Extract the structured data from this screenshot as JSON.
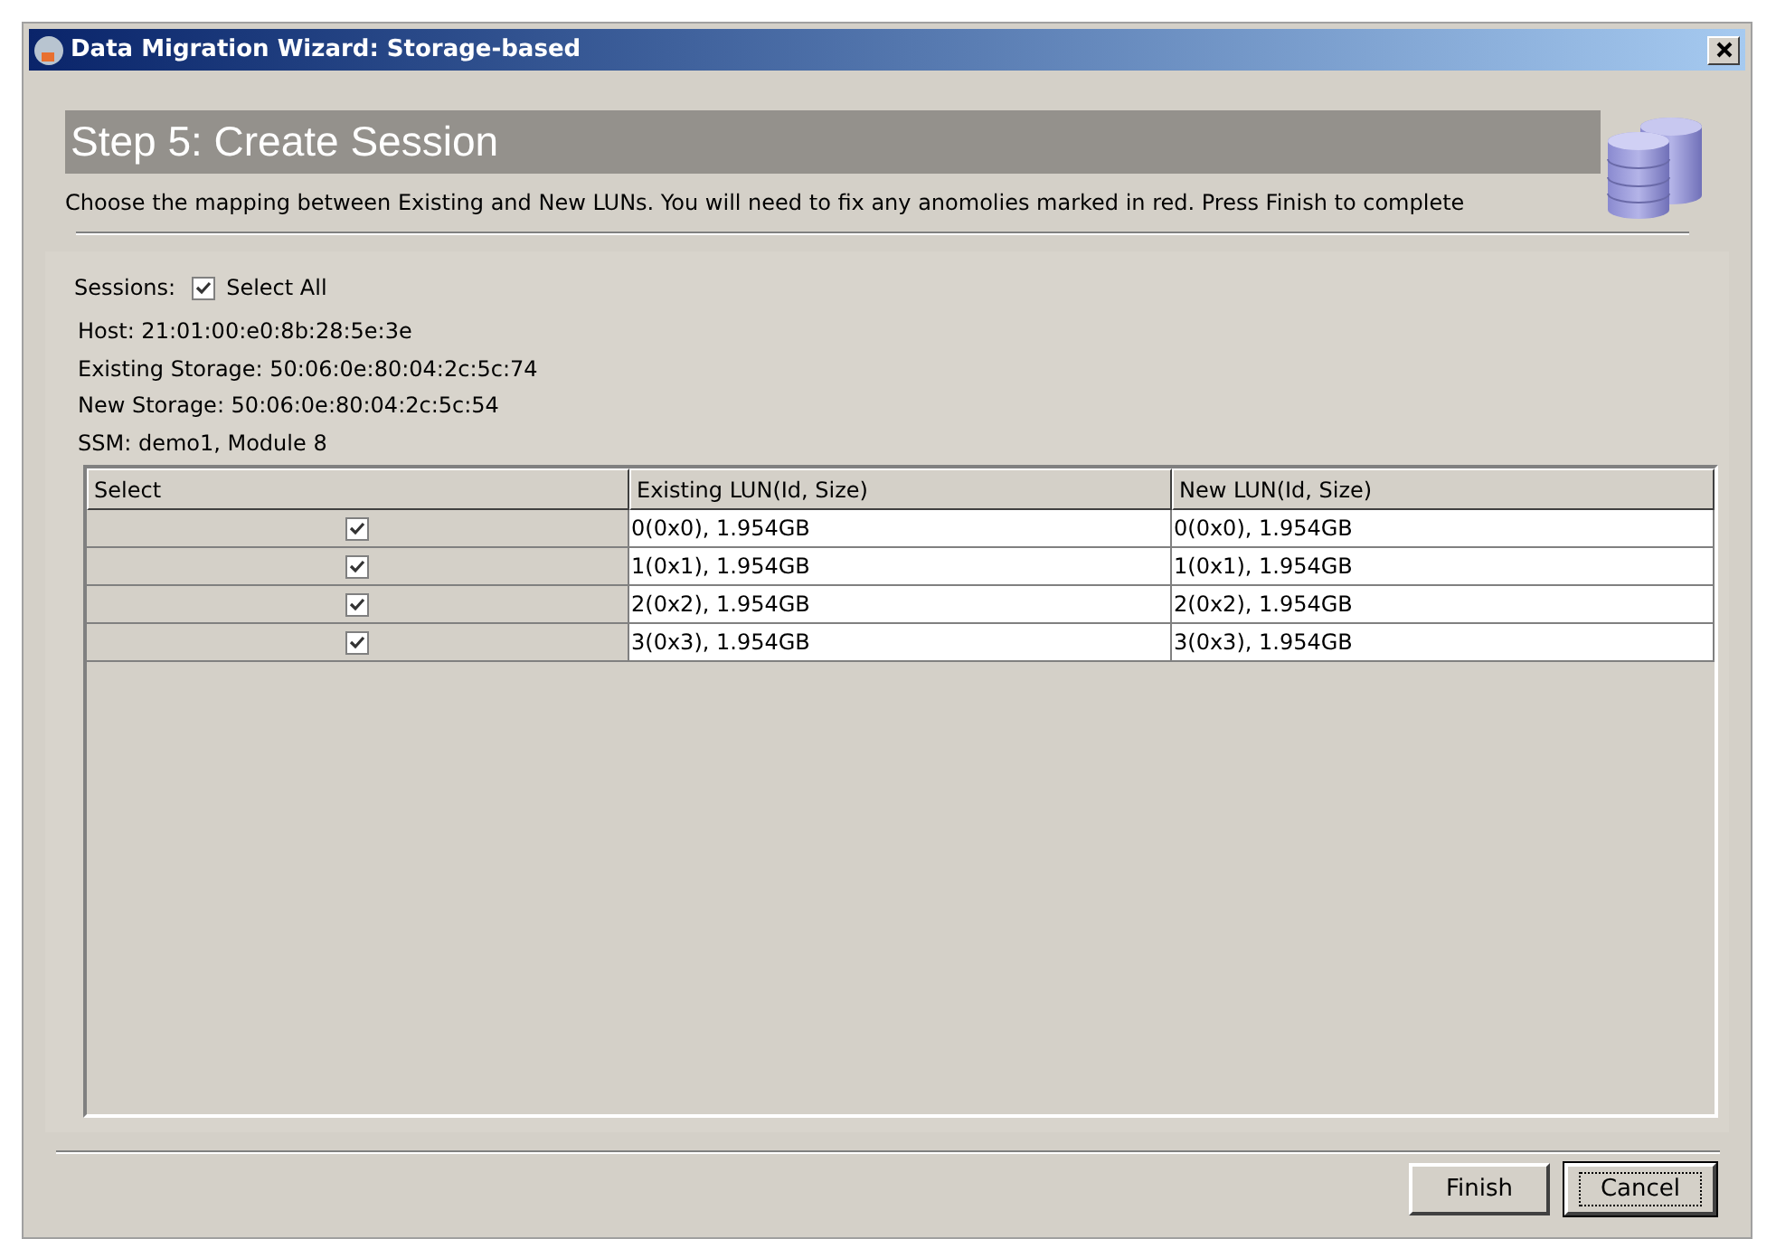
{
  "window": {
    "title": "Data Migration Wizard: Storage-based"
  },
  "header": {
    "title": "Step 5: Create Session",
    "description": "Choose the mapping between Existing and New LUNs. You will need to fix any anomolies marked in red. Press Finish to complete"
  },
  "sessions": {
    "label": "Sessions:",
    "select_all": {
      "label": "Select All",
      "checked": true
    }
  },
  "info": [
    "Host: 21:01:00:e0:8b:28:5e:3e",
    "Existing Storage: 50:06:0e:80:04:2c:5c:74",
    "New Storage: 50:06:0e:80:04:2c:5c:54",
    "SSM: demo1, Module 8"
  ],
  "table": {
    "columns": [
      "Select",
      "Existing LUN(Id, Size)",
      "New LUN(Id, Size)"
    ],
    "rows": [
      {
        "checked": true,
        "existing": "0(0x0), 1.954GB",
        "new": "0(0x0), 1.954GB"
      },
      {
        "checked": true,
        "existing": "1(0x1), 1.954GB",
        "new": "1(0x1), 1.954GB"
      },
      {
        "checked": true,
        "existing": "2(0x2), 1.954GB",
        "new": "2(0x2), 1.954GB"
      },
      {
        "checked": true,
        "existing": "3(0x3), 1.954GB",
        "new": "3(0x3), 1.954GB"
      }
    ]
  },
  "buttons": [
    {
      "label": "Finish",
      "focused": false
    },
    {
      "label": "Cancel",
      "focused": true
    }
  ]
}
